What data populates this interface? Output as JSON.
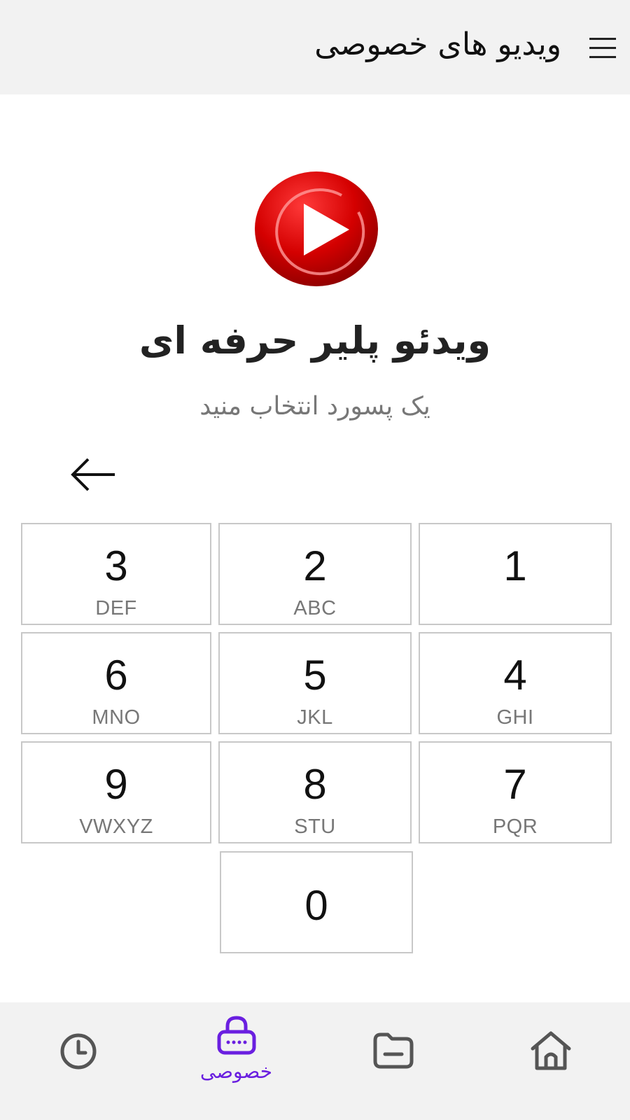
{
  "header": {
    "title": "ویدیو های خصوصی",
    "menu_icon": "hamburger-menu-icon"
  },
  "app": {
    "name": "ویدئو پلیر حرفه ای",
    "prompt": "یک پسورد انتخاب منید",
    "logo_icon": "play-logo-icon",
    "back_icon": "arrow-left-icon"
  },
  "keypad": {
    "keys": [
      {
        "digit": "1",
        "letters": ""
      },
      {
        "digit": "2",
        "letters": "ABC"
      },
      {
        "digit": "3",
        "letters": "DEF"
      },
      {
        "digit": "4",
        "letters": "GHI"
      },
      {
        "digit": "5",
        "letters": "JKL"
      },
      {
        "digit": "6",
        "letters": "MNO"
      },
      {
        "digit": "7",
        "letters": "PQR"
      },
      {
        "digit": "8",
        "letters": "STU"
      },
      {
        "digit": "9",
        "letters": "VWXYZ"
      },
      {
        "digit": "0",
        "letters": ""
      }
    ]
  },
  "bottom_nav": {
    "items": [
      {
        "icon": "home-icon",
        "label": ""
      },
      {
        "icon": "folder-icon",
        "label": ""
      },
      {
        "icon": "lock-icon",
        "label": "خصوصی",
        "active": true
      },
      {
        "icon": "clock-icon",
        "label": ""
      }
    ],
    "active_color": "#6a1fe0",
    "inactive_color": "#555555"
  },
  "colors": {
    "header_bg": "#f2f2f2",
    "logo_red": "#d40000",
    "key_border": "#c8c8c8"
  }
}
